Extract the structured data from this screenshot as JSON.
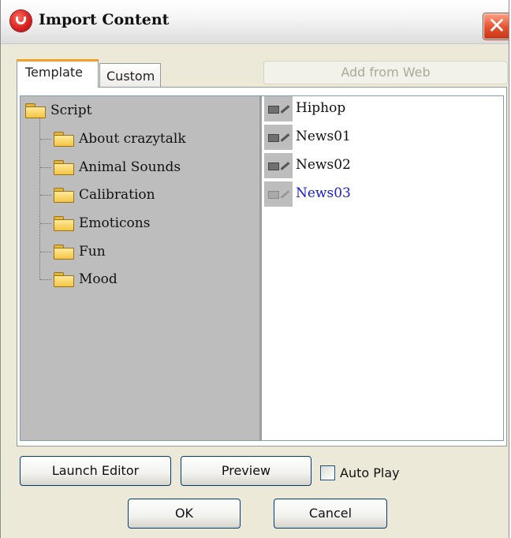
{
  "window": {
    "title": "Import Content",
    "close_glyph": "✕"
  },
  "tabs": [
    {
      "label": "Template",
      "active": true
    },
    {
      "label": "Custom",
      "active": false
    }
  ],
  "add_from_web_label": "Add from Web",
  "tree": {
    "root": {
      "label": "Script",
      "icon": "folder-icon"
    },
    "children": [
      {
        "label": "About crazytalk",
        "icon": "folder-icon"
      },
      {
        "label": "Animal Sounds",
        "icon": "folder-icon"
      },
      {
        "label": "Calibration",
        "icon": "folder-icon"
      },
      {
        "label": "Emoticons",
        "icon": "folder-icon"
      },
      {
        "label": "Fun",
        "icon": "folder-icon"
      },
      {
        "label": "Mood",
        "icon": "folder-icon"
      }
    ]
  },
  "list": {
    "items": [
      {
        "label": "Hiphop",
        "icon": "script-item-icon"
      },
      {
        "label": "News01",
        "icon": "script-item-icon"
      },
      {
        "label": "News02",
        "icon": "script-item-icon"
      },
      {
        "label": "News03",
        "icon": "script-item-icon",
        "selected": true
      }
    ]
  },
  "buttons": {
    "launch_editor": "Launch Editor",
    "preview": "Preview",
    "ok": "OK",
    "cancel": "Cancel"
  },
  "auto_play": {
    "label": "Auto Play",
    "checked": false
  },
  "colors": {
    "selected_text": "#1a1ad6",
    "close_button": "#e4512d",
    "tab_highlight": "#f3a02a"
  }
}
